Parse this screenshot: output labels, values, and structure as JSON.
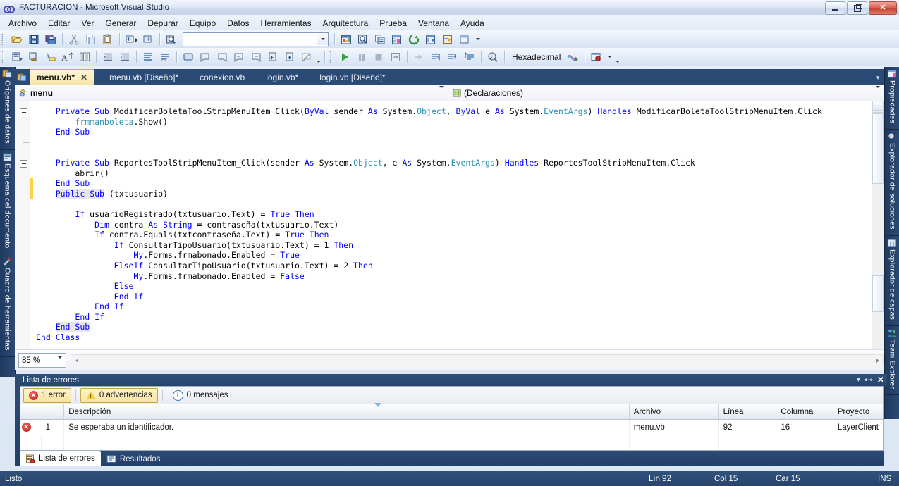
{
  "window": {
    "title": "FACTURACION - Microsoft Visual Studio",
    "app_icon": "visual-studio-infinity-icon",
    "minimize_label": "Minimizar",
    "maximize_label": "Restaurar",
    "close_label": "Cerrar"
  },
  "menubar": {
    "items": [
      "Archivo",
      "Editar",
      "Ver",
      "Generar",
      "Depurar",
      "Equipo",
      "Datos",
      "Herramientas",
      "Arquitectura",
      "Prueba",
      "Ventana",
      "Ayuda"
    ]
  },
  "toolbar_standard": {
    "combo_value": "",
    "buttons": [
      "open-file-icon",
      "save-icon",
      "save-all-icon",
      "cut-icon",
      "copy-icon",
      "paste-icon",
      "undo-icon",
      "redo-icon",
      "find-icon",
      "solution-explorer-icon",
      "object-browser-icon",
      "toolbox-icon",
      "properties-window-icon",
      "refresh-icon",
      "server-explorer-icon",
      "class-view-icon",
      "new-window-icon"
    ]
  },
  "toolbar_text_editor": {
    "memory_format": "Hexadecimal",
    "buttons": [
      "display-class-icon",
      "display-object-icon",
      "display-value-icon",
      "font-size-icon",
      "indent-guides-icon",
      "decrease-indent-icon",
      "increase-indent-icon",
      "comment-selection-icon",
      "uncomment-selection-icon",
      "toggle-bookmark-icon",
      "previous-bookmark-icon",
      "next-bookmark-icon",
      "previous-bookmark-folder-icon",
      "next-bookmark-folder-icon",
      "move-bookmark-up-icon",
      "move-bookmark-down-icon",
      "clear-bookmarks-icon",
      "start-debug-icon",
      "pause-debug-icon",
      "stop-debug-icon",
      "restart-debug-icon",
      "show-next-statement-icon",
      "step-into-icon",
      "step-over-icon",
      "step-out-icon",
      "debug-location-icon",
      "memory-window-icon",
      "threads-icon",
      "breakpoints-icon"
    ]
  },
  "left_dock": {
    "tabs": [
      {
        "label": "Orígenes de datos",
        "icon": "data-sources-icon"
      },
      {
        "label": "Esquema del documento",
        "icon": "document-outline-icon"
      },
      {
        "label": "Cuadro de herramientas",
        "icon": "toolbox-icon"
      }
    ]
  },
  "right_dock": {
    "tabs": [
      {
        "label": "Propiedades",
        "icon": "properties-icon"
      },
      {
        "label": "Explorador de soluciones",
        "icon": "solution-explorer-icon"
      },
      {
        "label": "Explorador de capas",
        "icon": "layer-explorer-icon"
      },
      {
        "label": "Team Explorer",
        "icon": "team-explorer-icon"
      }
    ]
  },
  "document_tabs": [
    {
      "label": "menu.vb*",
      "active": true,
      "closable": true
    },
    {
      "label": "menu.vb [Diseño]*",
      "active": false,
      "closable": false
    },
    {
      "label": "conexion.vb",
      "active": false,
      "closable": false
    },
    {
      "label": "login.vb*",
      "active": false,
      "closable": false
    },
    {
      "label": "login.vb [Diseño]*",
      "active": false,
      "closable": false
    }
  ],
  "nav_bar": {
    "class_icon": "module-icon",
    "class_value": "menu",
    "member_icon": "declarations-icon",
    "member_value": "(Declaraciones)"
  },
  "editor": {
    "zoom": "85 %",
    "code_lines": [
      {
        "fold": "minus",
        "change": "none",
        "tokens": [
          {
            "t": "    ",
            "c": "pl"
          },
          {
            "t": "Private",
            "c": "kw"
          },
          {
            "t": " "
          },
          {
            "t": "Sub",
            "c": "kw"
          },
          {
            "t": " ModificarBoletaToolStripMenuItem_Click("
          },
          {
            "t": "ByVal",
            "c": "kw"
          },
          {
            "t": " sender "
          },
          {
            "t": "As",
            "c": "kw"
          },
          {
            "t": " System."
          },
          {
            "t": "Object",
            "c": "ty"
          },
          {
            "t": ", "
          },
          {
            "t": "ByVal",
            "c": "kw"
          },
          {
            "t": " e "
          },
          {
            "t": "As",
            "c": "kw"
          },
          {
            "t": " System."
          },
          {
            "t": "EventArgs",
            "c": "ty"
          },
          {
            "t": ") "
          },
          {
            "t": "Handles",
            "c": "kw"
          },
          {
            "t": " ModificarBoletaToolStripMenuItem.Click"
          }
        ]
      },
      {
        "fold": "bar",
        "change": "none",
        "tokens": [
          {
            "t": "        "
          },
          {
            "t": "frmmanboleta",
            "c": "ty"
          },
          {
            "t": ".Show()"
          }
        ]
      },
      {
        "fold": "bar",
        "change": "none",
        "tokens": [
          {
            "t": "    "
          },
          {
            "t": "End",
            "c": "kw"
          },
          {
            "t": " "
          },
          {
            "t": "Sub",
            "c": "kw"
          }
        ]
      },
      {
        "fold": "endline",
        "change": "none",
        "tokens": []
      },
      {
        "fold": "none",
        "change": "none",
        "tokens": []
      },
      {
        "fold": "minus",
        "change": "none",
        "tokens": [
          {
            "t": "    "
          },
          {
            "t": "Private",
            "c": "kw"
          },
          {
            "t": " "
          },
          {
            "t": "Sub",
            "c": "kw"
          },
          {
            "t": " ReportesToolStripMenuItem_Click(sender "
          },
          {
            "t": "As",
            "c": "kw"
          },
          {
            "t": " System."
          },
          {
            "t": "Object",
            "c": "ty"
          },
          {
            "t": ", e "
          },
          {
            "t": "As",
            "c": "kw"
          },
          {
            "t": " System."
          },
          {
            "t": "EventArgs",
            "c": "ty"
          },
          {
            "t": ") "
          },
          {
            "t": "Handles",
            "c": "kw"
          },
          {
            "t": " ReportesToolStripMenuItem.Click"
          }
        ]
      },
      {
        "fold": "bar",
        "change": "none",
        "tokens": [
          {
            "t": "        abrir()"
          }
        ]
      },
      {
        "fold": "bar",
        "change": "yellow",
        "tokens": [
          {
            "t": "    "
          },
          {
            "t": "End",
            "c": "kw"
          },
          {
            "t": " "
          },
          {
            "t": "Sub",
            "c": "kw"
          }
        ]
      },
      {
        "fold": "bar",
        "change": "yellow",
        "tokens": [
          {
            "t": "    "
          },
          {
            "t": "Public",
            "c": "kw hl"
          },
          {
            "t": " ",
            "c": "hl"
          },
          {
            "t": "Sub",
            "c": "kw hl"
          },
          {
            "t": " (txtusuario)"
          }
        ]
      },
      {
        "fold": "bar",
        "change": "none",
        "tokens": []
      },
      {
        "fold": "bar",
        "change": "none",
        "tokens": [
          {
            "t": "        "
          },
          {
            "t": "If",
            "c": "kw"
          },
          {
            "t": " usuarioRegistrado(txtusuario.Text) = "
          },
          {
            "t": "True",
            "c": "kw"
          },
          {
            "t": " "
          },
          {
            "t": "Then",
            "c": "kw"
          }
        ]
      },
      {
        "fold": "bar",
        "change": "none",
        "tokens": [
          {
            "t": "            "
          },
          {
            "t": "Dim",
            "c": "kw"
          },
          {
            "t": " contra "
          },
          {
            "t": "As",
            "c": "kw"
          },
          {
            "t": " "
          },
          {
            "t": "String",
            "c": "kw"
          },
          {
            "t": " = contraseña(txtusuario.Text)"
          }
        ]
      },
      {
        "fold": "bar",
        "change": "none",
        "tokens": [
          {
            "t": "            "
          },
          {
            "t": "If",
            "c": "kw"
          },
          {
            "t": " contra.Equals(txtcontraseña.Text) = "
          },
          {
            "t": "True",
            "c": "kw"
          },
          {
            "t": " "
          },
          {
            "t": "Then",
            "c": "kw"
          }
        ]
      },
      {
        "fold": "bar",
        "change": "none",
        "tokens": [
          {
            "t": "                "
          },
          {
            "t": "If",
            "c": "kw"
          },
          {
            "t": " ConsultarTipoUsuario(txtusuario.Text) = 1 "
          },
          {
            "t": "Then",
            "c": "kw"
          }
        ]
      },
      {
        "fold": "bar",
        "change": "none",
        "tokens": [
          {
            "t": "                    "
          },
          {
            "t": "My",
            "c": "kw"
          },
          {
            "t": ".Forms.frmabonado.Enabled = "
          },
          {
            "t": "True",
            "c": "kw"
          }
        ]
      },
      {
        "fold": "bar",
        "change": "none",
        "tokens": [
          {
            "t": "                "
          },
          {
            "t": "ElseIf",
            "c": "kw"
          },
          {
            "t": " ConsultarTipoUsuario(txtusuario.Text) = 2 "
          },
          {
            "t": "Then",
            "c": "kw"
          }
        ]
      },
      {
        "fold": "bar",
        "change": "none",
        "tokens": [
          {
            "t": "                    "
          },
          {
            "t": "My",
            "c": "kw"
          },
          {
            "t": ".Forms.frmabonado.Enabled = "
          },
          {
            "t": "False",
            "c": "kw"
          }
        ]
      },
      {
        "fold": "bar",
        "change": "none",
        "tokens": [
          {
            "t": "                "
          },
          {
            "t": "Else",
            "c": "kw"
          }
        ]
      },
      {
        "fold": "bar",
        "change": "none",
        "tokens": [
          {
            "t": "                "
          },
          {
            "t": "End",
            "c": "kw"
          },
          {
            "t": " "
          },
          {
            "t": "If",
            "c": "kw"
          }
        ]
      },
      {
        "fold": "bar",
        "change": "none",
        "tokens": [
          {
            "t": "            "
          },
          {
            "t": "End",
            "c": "kw"
          },
          {
            "t": " "
          },
          {
            "t": "If",
            "c": "kw"
          }
        ]
      },
      {
        "fold": "bar",
        "change": "none",
        "tokens": [
          {
            "t": "        "
          },
          {
            "t": "End",
            "c": "kw"
          },
          {
            "t": " "
          },
          {
            "t": "If",
            "c": "kw"
          }
        ]
      },
      {
        "fold": "bar",
        "change": "none",
        "tokens": [
          {
            "t": "    "
          },
          {
            "t": "End",
            "c": "kw hl"
          },
          {
            "t": " ",
            "c": "hl"
          },
          {
            "t": "Sub",
            "c": "kw hl"
          }
        ]
      },
      {
        "fold": "none",
        "change": "none",
        "tokens": [
          {
            "t": "End",
            "c": "kw"
          },
          {
            "t": " "
          },
          {
            "t": "Class",
            "c": "kw"
          }
        ]
      }
    ]
  },
  "error_panel": {
    "title": "Lista de errores",
    "filters": [
      {
        "label": "1 error",
        "icon": "error-icon",
        "active": true
      },
      {
        "label": "0 advertencias",
        "icon": "warning-icon",
        "active": true
      },
      {
        "label": "0 mensajes",
        "icon": "info-icon",
        "active": false
      }
    ],
    "columns": [
      "",
      "",
      "Descripción",
      "Archivo",
      "Línea",
      "Columna",
      "Proyecto"
    ],
    "rows": [
      {
        "icon": "error-icon",
        "num": "1",
        "descripcion": "Se esperaba un identificador.",
        "archivo": "menu.vb",
        "linea": "92",
        "columna": "16",
        "proyecto": "LayerClient"
      }
    ],
    "tabs": [
      {
        "label": "Lista de errores",
        "icon": "error-list-icon",
        "active": true
      },
      {
        "label": "Resultados",
        "icon": "output-icon",
        "active": false
      }
    ],
    "controls": [
      "dropdown-icon",
      "pin-icon",
      "close-icon"
    ]
  },
  "statusbar": {
    "ready": "Listo",
    "line_label": "Lín 92",
    "col_label": "Col 15",
    "char_label": "Car 15",
    "insert_label": "INS"
  },
  "colors": {
    "chrome_blue": "#27456d",
    "accent_tab": "#fbeec0",
    "keyword": "#0000ff",
    "type": "#2b91af",
    "error_red": "#b7201a",
    "warning_yellow": "#f5d23b"
  }
}
